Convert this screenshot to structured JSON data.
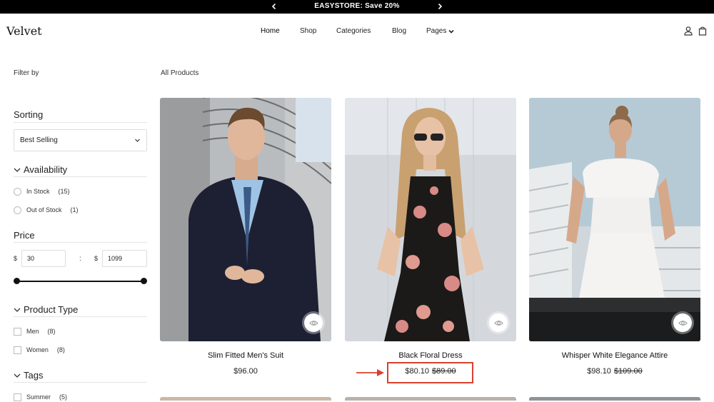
{
  "announcement": {
    "text": "EASYSTORE: Save 20%"
  },
  "header": {
    "logo": "Velvet",
    "nav": [
      {
        "label": "Home"
      },
      {
        "label": "Shop"
      },
      {
        "label": "Categories"
      },
      {
        "label": "Blog"
      },
      {
        "label": "Pages"
      }
    ],
    "icons": [
      "user-icon",
      "bag-icon"
    ]
  },
  "sidebar": {
    "filter_by": "Filter by",
    "sorting": {
      "title": "Sorting",
      "selected": "Best Selling"
    },
    "availability": {
      "title": "Availability",
      "options": [
        {
          "label": "In Stock",
          "count": "(15)"
        },
        {
          "label": "Out of Stock",
          "count": "(1)"
        }
      ]
    },
    "price": {
      "title": "Price",
      "currency": "$",
      "min": "30",
      "max": "1099",
      "separator": ":"
    },
    "product_type": {
      "title": "Product Type",
      "options": [
        {
          "label": "Men",
          "count": "(8)"
        },
        {
          "label": "Women",
          "count": "(8)"
        }
      ]
    },
    "tags": {
      "title": "Tags",
      "options": [
        {
          "label": "Summer",
          "count": "(5)"
        }
      ]
    }
  },
  "main": {
    "title": "All Products",
    "products": [
      {
        "name": "Slim Fitted Men's Suit",
        "price": "$96.00",
        "old_price": ""
      },
      {
        "name": "Black Floral Dress",
        "price": "$80.10",
        "old_price": "$89.00"
      },
      {
        "name": "Whisper White Elegance Attire",
        "price": "$98.10",
        "old_price": "$109.00"
      }
    ]
  },
  "colors": {
    "announcement_bg": "#000000",
    "highlight": "#d8412f",
    "text": "#222222"
  }
}
